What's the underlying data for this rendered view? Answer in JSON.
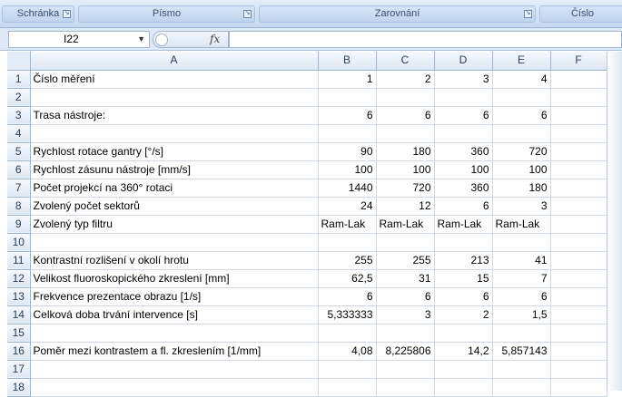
{
  "ribbon": {
    "groups": [
      {
        "label": "Schránka",
        "launcher": "↘"
      },
      {
        "label": "Písmo",
        "launcher": "↘"
      },
      {
        "label": "Zarovnání",
        "launcher": "↘"
      },
      {
        "label": "Číslo",
        "launcher": ""
      }
    ]
  },
  "formula_bar": {
    "cell_ref": "I22",
    "dropdown_glyph": "▼",
    "fx_label": "fx",
    "formula": ""
  },
  "sheet": {
    "columns": [
      "A",
      "B",
      "C",
      "D",
      "E",
      "F"
    ],
    "rows": [
      {
        "n": "1",
        "cells": [
          "Číslo měření",
          "1",
          "2",
          "3",
          "4",
          ""
        ]
      },
      {
        "n": "2",
        "cells": [
          "",
          "",
          "",
          "",
          "",
          ""
        ]
      },
      {
        "n": "3",
        "cells": [
          "Trasa nástroje:",
          "6",
          "6",
          "6",
          "6",
          ""
        ]
      },
      {
        "n": "4",
        "cells": [
          "",
          "",
          "",
          "",
          "",
          ""
        ]
      },
      {
        "n": "5",
        "cells": [
          "Rychlost rotace gantry [°/s]",
          "90",
          "180",
          "360",
          "720",
          ""
        ]
      },
      {
        "n": "6",
        "cells": [
          "Rychlost zásunu nástroje [mm/s]",
          "100",
          "100",
          "100",
          "100",
          ""
        ]
      },
      {
        "n": "7",
        "cells": [
          "Počet projekcí na 360° rotaci",
          "1440",
          "720",
          "360",
          "180",
          ""
        ]
      },
      {
        "n": "8",
        "cells": [
          "Zvolený počet sektorů",
          "24",
          "12",
          "6",
          "3",
          ""
        ]
      },
      {
        "n": "9",
        "cells": [
          "Zvolený typ filtru",
          "Ram-Lak",
          "Ram-Lak",
          "Ram-Lak",
          "Ram-Lak",
          ""
        ]
      },
      {
        "n": "10",
        "cells": [
          "",
          "",
          "",
          "",
          "",
          ""
        ]
      },
      {
        "n": "11",
        "cells": [
          "Kontrastní rozlišení v okolí hrotu",
          "255",
          "255",
          "213",
          "41",
          ""
        ]
      },
      {
        "n": "12",
        "cells": [
          "Velikost fluoroskopického zkreslení [mm]",
          "62,5",
          "31",
          "15",
          "7",
          ""
        ]
      },
      {
        "n": "13",
        "cells": [
          "Frekvence prezentace obrazu [1/s]",
          "6",
          "6",
          "6",
          "6",
          ""
        ]
      },
      {
        "n": "14",
        "cells": [
          "Celková doba trvání intervence [s]",
          "5,333333",
          "3",
          "2",
          "1,5",
          ""
        ]
      },
      {
        "n": "15",
        "cells": [
          "",
          "",
          "",
          "",
          "",
          ""
        ]
      },
      {
        "n": "16",
        "cells": [
          "Poměr mezi kontrastem a fl. zkreslením [1/mm]",
          "4,08",
          "8,225806",
          "14,2",
          "5,857143",
          ""
        ]
      },
      {
        "n": "17",
        "cells": [
          "",
          "",
          "",
          "",
          "",
          ""
        ]
      },
      {
        "n": "18",
        "cells": [
          "",
          "",
          "",
          "",
          "",
          ""
        ]
      }
    ]
  }
}
